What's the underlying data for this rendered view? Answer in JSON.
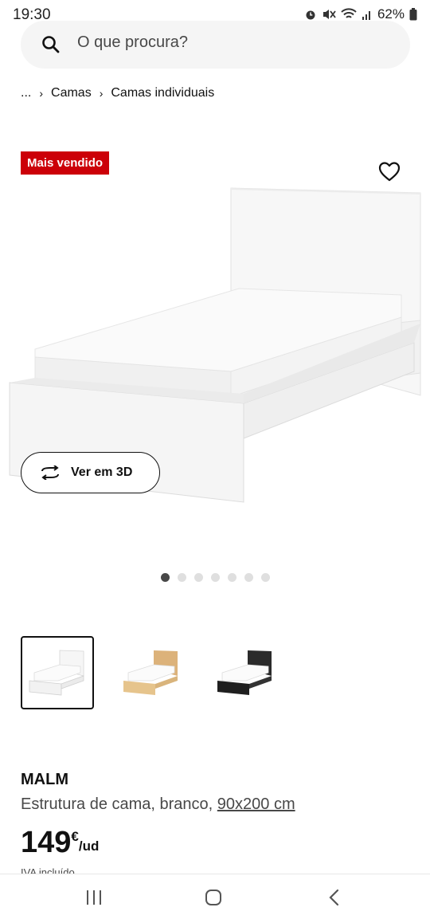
{
  "status": {
    "time": "19:30",
    "battery": "62%",
    "icons": [
      "alarm-icon",
      "mute-icon",
      "wifi-icon",
      "signal-icon",
      "battery-icon"
    ]
  },
  "search": {
    "placeholder": "O que procura?"
  },
  "breadcrumb": {
    "items": [
      "...",
      "Camas",
      "Camas individuais"
    ]
  },
  "badge": {
    "label": "Mais vendido",
    "color": "#cc0008"
  },
  "hero": {
    "view3d_label": "Ver em 3D",
    "carousel_count": 7,
    "carousel_active": 0
  },
  "variants": [
    {
      "name": "branco",
      "color": "#ffffff",
      "selected": true
    },
    {
      "name": "carvalho",
      "color": "#e6c48c",
      "selected": false
    },
    {
      "name": "preto",
      "color": "#2b2b2b",
      "selected": false
    }
  ],
  "product": {
    "name": "MALM",
    "description": "Estrutura de cama, branco, ",
    "size": "90x200 cm",
    "price_integer": "149",
    "price_currency": "€",
    "price_unit": "/ud",
    "vat_note": "IVA incluído"
  },
  "nav": {
    "icons": [
      "recents-icon",
      "home-icon",
      "back-icon"
    ]
  }
}
